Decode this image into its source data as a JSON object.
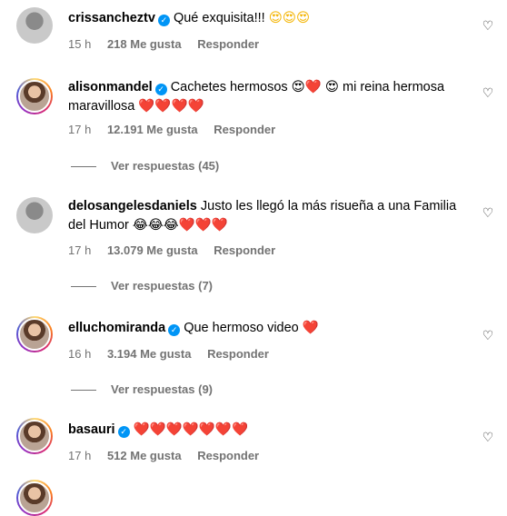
{
  "comments": [
    {
      "username": "crissancheztv",
      "verified": true,
      "text": "Qué exquisita!!!",
      "emojis": "😍😍😍",
      "time": "15 h",
      "likes": "218 Me gusta",
      "reply": "Responder",
      "replies": ""
    },
    {
      "username": "alisonmandel",
      "verified": true,
      "text": "Cachetes hermosos 😍❤️ 😍 mi reina hermosa maravillosa ❤️❤️❤️❤️",
      "time": "17 h",
      "likes": "12.191 Me gusta",
      "reply": "Responder",
      "replies": "Ver respuestas (45)"
    },
    {
      "username": "delosangelesdaniels",
      "verified": false,
      "text": "Justo les llegó la más risueña a una Familia del Humor 😂😂😂❤️❤️❤️",
      "time": "17 h",
      "likes": "13.079 Me gusta",
      "reply": "Responder",
      "replies": "Ver respuestas (7)"
    },
    {
      "username": "elluchomiranda",
      "verified": true,
      "text": "Que hermoso video ❤️",
      "time": "16 h",
      "likes": "3.194 Me gusta",
      "reply": "Responder",
      "replies": "Ver respuestas (9)"
    },
    {
      "username": "basauri",
      "verified": true,
      "text": "❤️❤️❤️❤️❤️❤️❤️",
      "time": "17 h",
      "likes": "512 Me gusta",
      "reply": "Responder",
      "replies": ""
    }
  ],
  "icons": {
    "like": "heart-outline-icon",
    "verified": "verified-badge-icon"
  }
}
